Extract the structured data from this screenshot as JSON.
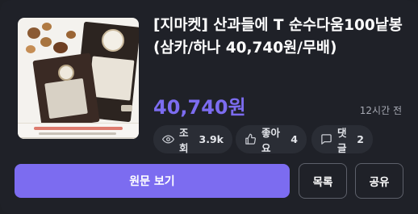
{
  "post": {
    "title": "[지마켓] 산과들에 T 순수다움100낱봉 (삼카/하나 40,740원/무배)",
    "price": "40,740원",
    "time_ago": "12시간 전",
    "thumbnail_icon": "nut-snack-product-image"
  },
  "stats": {
    "views_label": "조회",
    "views_value": "3.9k",
    "likes_label": "좋아요",
    "likes_value": "4",
    "comments_label": "댓글",
    "comments_value": "2"
  },
  "actions": {
    "view_original": "원문 보기",
    "list": "목록",
    "share": "공유"
  },
  "colors": {
    "background": "#1f2128",
    "accent": "#7c6cf0",
    "chip_bg": "#2a2d35",
    "muted_text": "#a6a9b3"
  }
}
